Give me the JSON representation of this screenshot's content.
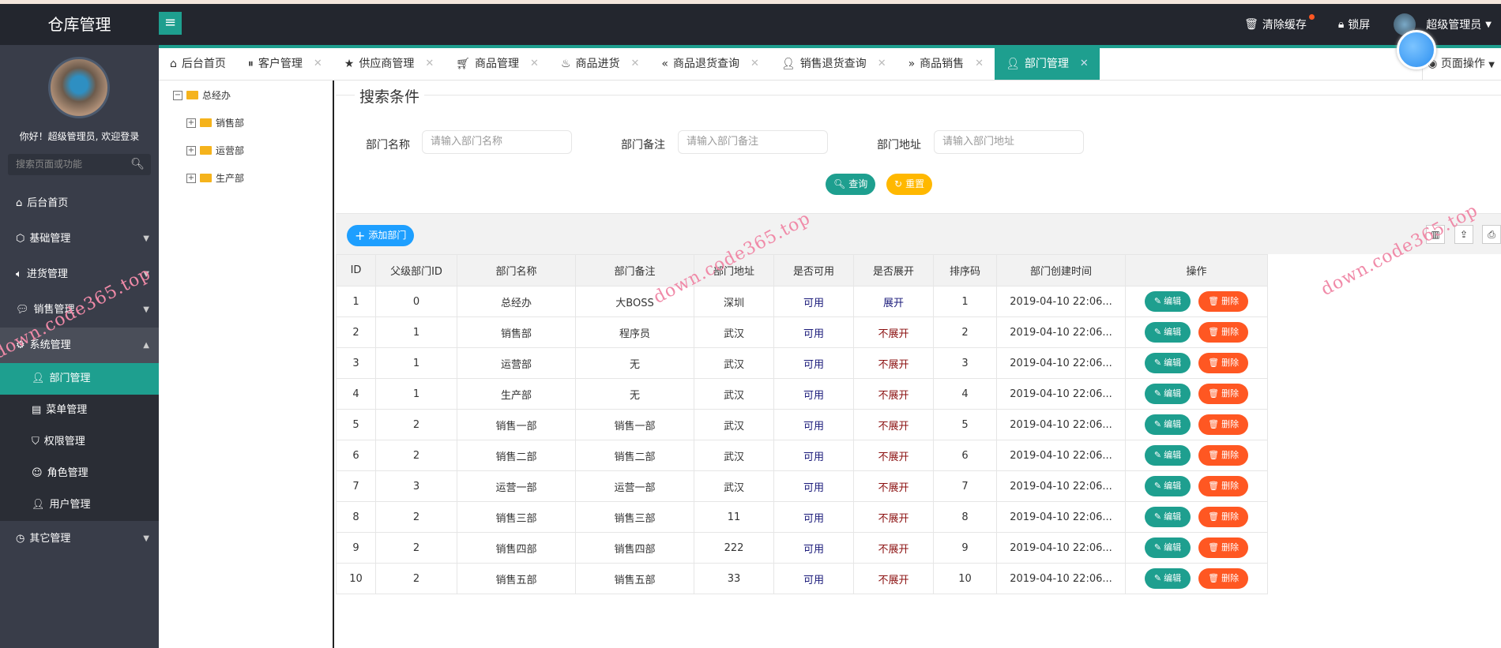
{
  "app": {
    "title": "仓库管理"
  },
  "header": {
    "clear_cache": "清除缓存",
    "lock": "锁屏",
    "user": "超级管理员"
  },
  "sidebar": {
    "greeting": "你好！超级管理员, 欢迎登录",
    "search_placeholder": "搜索页面或功能",
    "items": [
      {
        "label": "后台首页",
        "icon": "home-icon"
      },
      {
        "label": "基础管理",
        "icon": "cube-icon"
      },
      {
        "label": "进货管理",
        "icon": "volume-icon"
      },
      {
        "label": "销售管理",
        "icon": "chat-icon"
      },
      {
        "label": "系统管理",
        "icon": "gear-icon"
      },
      {
        "label": "其它管理",
        "icon": "clock-icon"
      }
    ],
    "sub_items": [
      {
        "label": "部门管理",
        "icon": "user-icon"
      },
      {
        "label": "菜单管理",
        "icon": "menu-icon"
      },
      {
        "label": "权限管理",
        "icon": "shield-icon"
      },
      {
        "label": "角色管理",
        "icon": "smile-icon"
      },
      {
        "label": "用户管理",
        "icon": "person-icon"
      }
    ]
  },
  "tabs": [
    {
      "label": "后台首页"
    },
    {
      "label": "客户管理"
    },
    {
      "label": "供应商管理"
    },
    {
      "label": "商品管理"
    },
    {
      "label": "商品进货"
    },
    {
      "label": "商品退货查询"
    },
    {
      "label": "销售退货查询"
    },
    {
      "label": "商品销售"
    },
    {
      "label": "部门管理"
    }
  ],
  "page_ops": "页面操作",
  "tree": {
    "root": "总经办",
    "children": [
      "销售部",
      "运营部",
      "生产部"
    ]
  },
  "search": {
    "legend": "搜索条件",
    "fields": [
      {
        "label": "部门名称",
        "placeholder": "请输入部门名称"
      },
      {
        "label": "部门备注",
        "placeholder": "请输入部门备注"
      },
      {
        "label": "部门地址",
        "placeholder": "请输入部门地址"
      }
    ],
    "query": "查询",
    "reset": "重置"
  },
  "toolbar": {
    "add": "添加部门"
  },
  "table": {
    "headers": [
      "ID",
      "父级部门ID",
      "部门名称",
      "部门备注",
      "部门地址",
      "是否可用",
      "是否展开",
      "排序码",
      "部门创建时间",
      "操作"
    ],
    "edit": "编辑",
    "delete": "删除",
    "rows": [
      [
        "1",
        "0",
        "总经办",
        "大BOSS",
        "深圳",
        "可用",
        "展开",
        "1",
        "2019-04-10 22:06..."
      ],
      [
        "2",
        "1",
        "销售部",
        "程序员",
        "武汉",
        "可用",
        "不展开",
        "2",
        "2019-04-10 22:06..."
      ],
      [
        "3",
        "1",
        "运营部",
        "无",
        "武汉",
        "可用",
        "不展开",
        "3",
        "2019-04-10 22:06..."
      ],
      [
        "4",
        "1",
        "生产部",
        "无",
        "武汉",
        "可用",
        "不展开",
        "4",
        "2019-04-10 22:06..."
      ],
      [
        "5",
        "2",
        "销售一部",
        "销售一部",
        "武汉",
        "可用",
        "不展开",
        "5",
        "2019-04-10 22:06..."
      ],
      [
        "6",
        "2",
        "销售二部",
        "销售二部",
        "武汉",
        "可用",
        "不展开",
        "6",
        "2019-04-10 22:06..."
      ],
      [
        "7",
        "3",
        "运营一部",
        "运营一部",
        "武汉",
        "可用",
        "不展开",
        "7",
        "2019-04-10 22:06..."
      ],
      [
        "8",
        "2",
        "销售三部",
        "销售三部",
        "11",
        "可用",
        "不展开",
        "8",
        "2019-04-10 22:06..."
      ],
      [
        "9",
        "2",
        "销售四部",
        "销售四部",
        "222",
        "可用",
        "不展开",
        "9",
        "2019-04-10 22:06..."
      ],
      [
        "10",
        "2",
        "销售五部",
        "销售五部",
        "33",
        "可用",
        "不展开",
        "10",
        "2019-04-10 22:06..."
      ]
    ]
  },
  "watermark": "down.code365.top",
  "colors": {
    "teal": "#1e9f8f",
    "orange": "#ff5722",
    "blue": "#1e9fff",
    "yellow": "#ffb800",
    "dark": "#23262e",
    "sidebar": "#393d49"
  }
}
